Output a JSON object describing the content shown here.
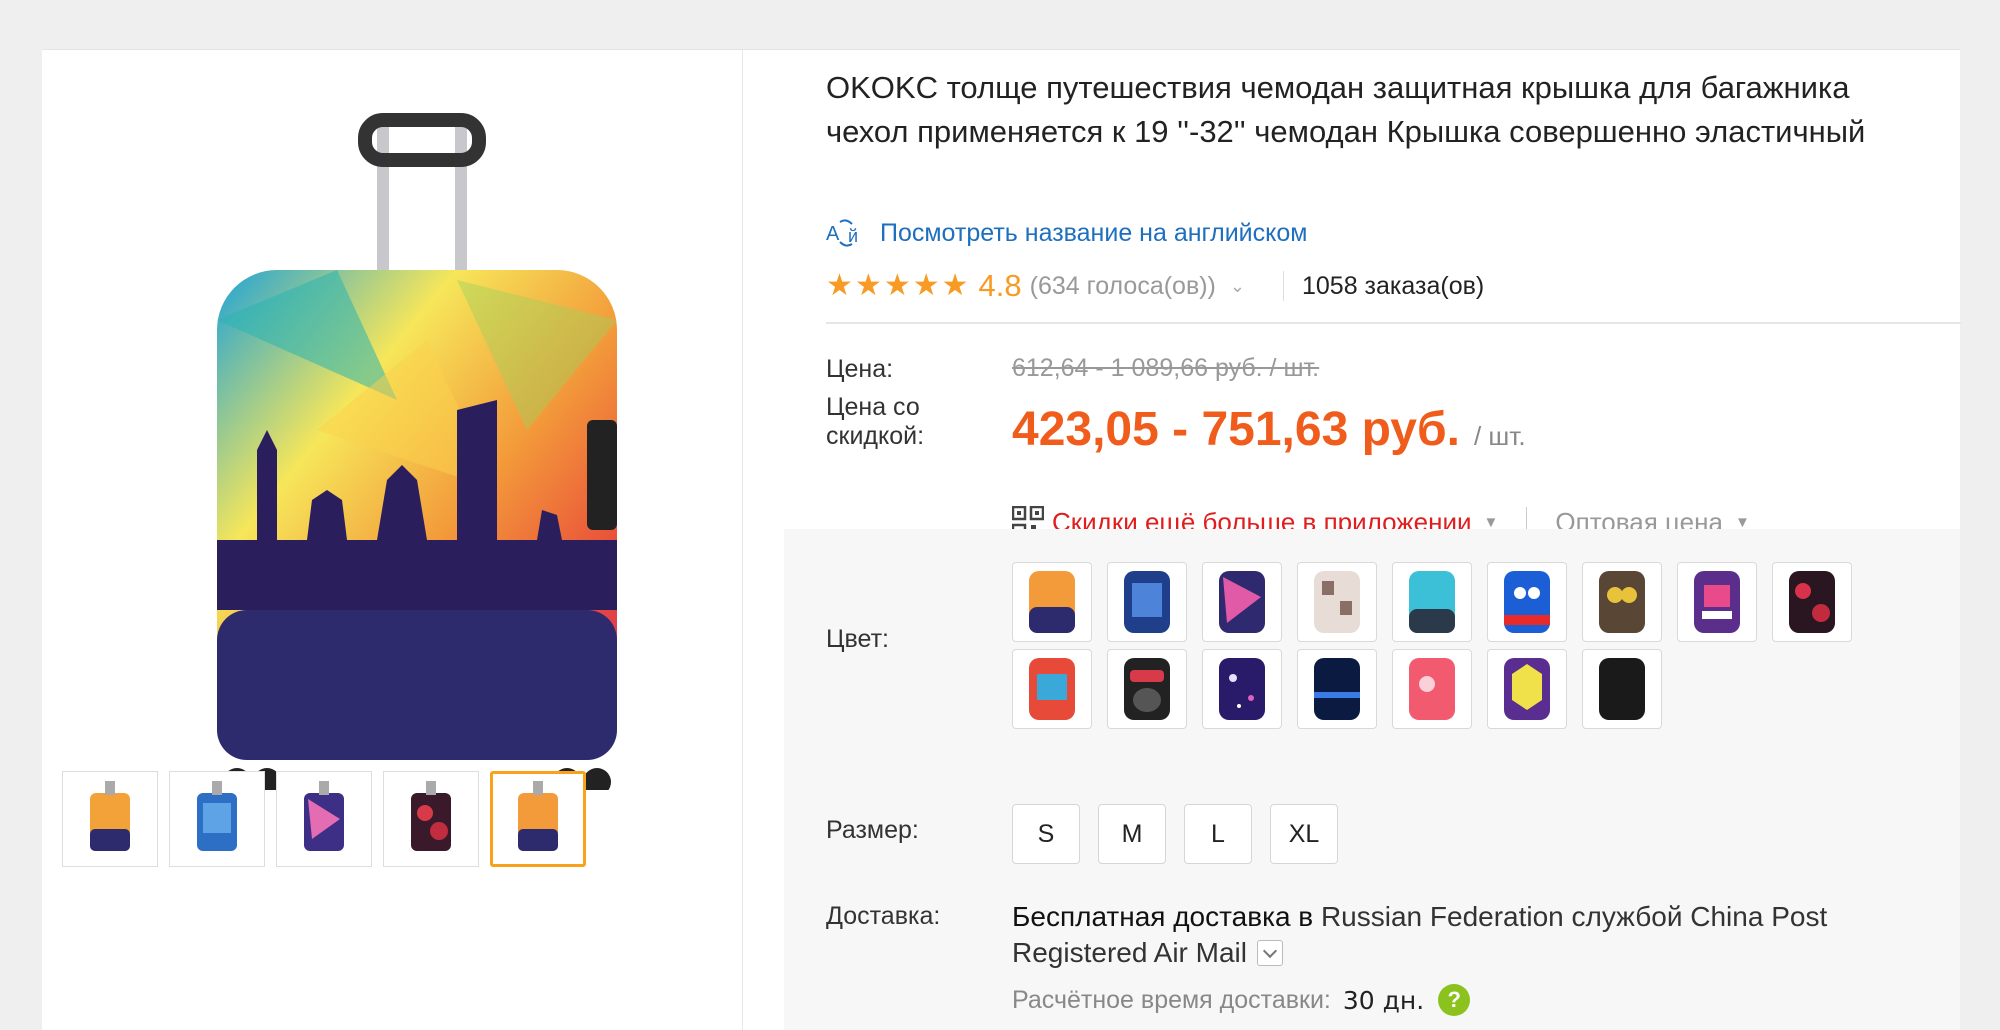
{
  "product": {
    "title": "OKOKC толще путешествия чемодан защитная крышка для багажника чехол применяется к 19 ''-32'' чемодан Крышка совершенно эластичный",
    "translate_link": "Посмотреть название на английском",
    "translate_icon": "translate-icon"
  },
  "rating": {
    "stars": 5,
    "value": "4.8",
    "votes": "(634 голоса(ов))",
    "orders": "1058 заказа(ов)"
  },
  "price": {
    "label": "Цена:",
    "original": "612,64 - 1 089,66 руб. / шт.",
    "discount_label": "Цена со скидкой:",
    "discount_value": "423,05 - 751,63 руб.",
    "unit": "/ шт.",
    "app_promo": "Скидки ещё больше в приложении",
    "wholesale": "Оптовая цена",
    "accent_color": "#f05c1c",
    "promo_color": "#e11d1d"
  },
  "options": {
    "color_label": "Цвет:",
    "size_label": "Размер:",
    "sizes": [
      "S",
      "M",
      "L",
      "XL"
    ]
  },
  "delivery": {
    "label": "Доставка:",
    "free_text": "Бесплатная доставка в",
    "rest_text": "Russian Federation службой China Post Registered Air Mail",
    "eta_label": "Расчётное время доставки:",
    "eta_value": "30 дн.",
    "help_icon": "?"
  },
  "gallery": {
    "thumbnail_count": 5,
    "active_index": 4,
    "active_color": "#f7a21a"
  }
}
